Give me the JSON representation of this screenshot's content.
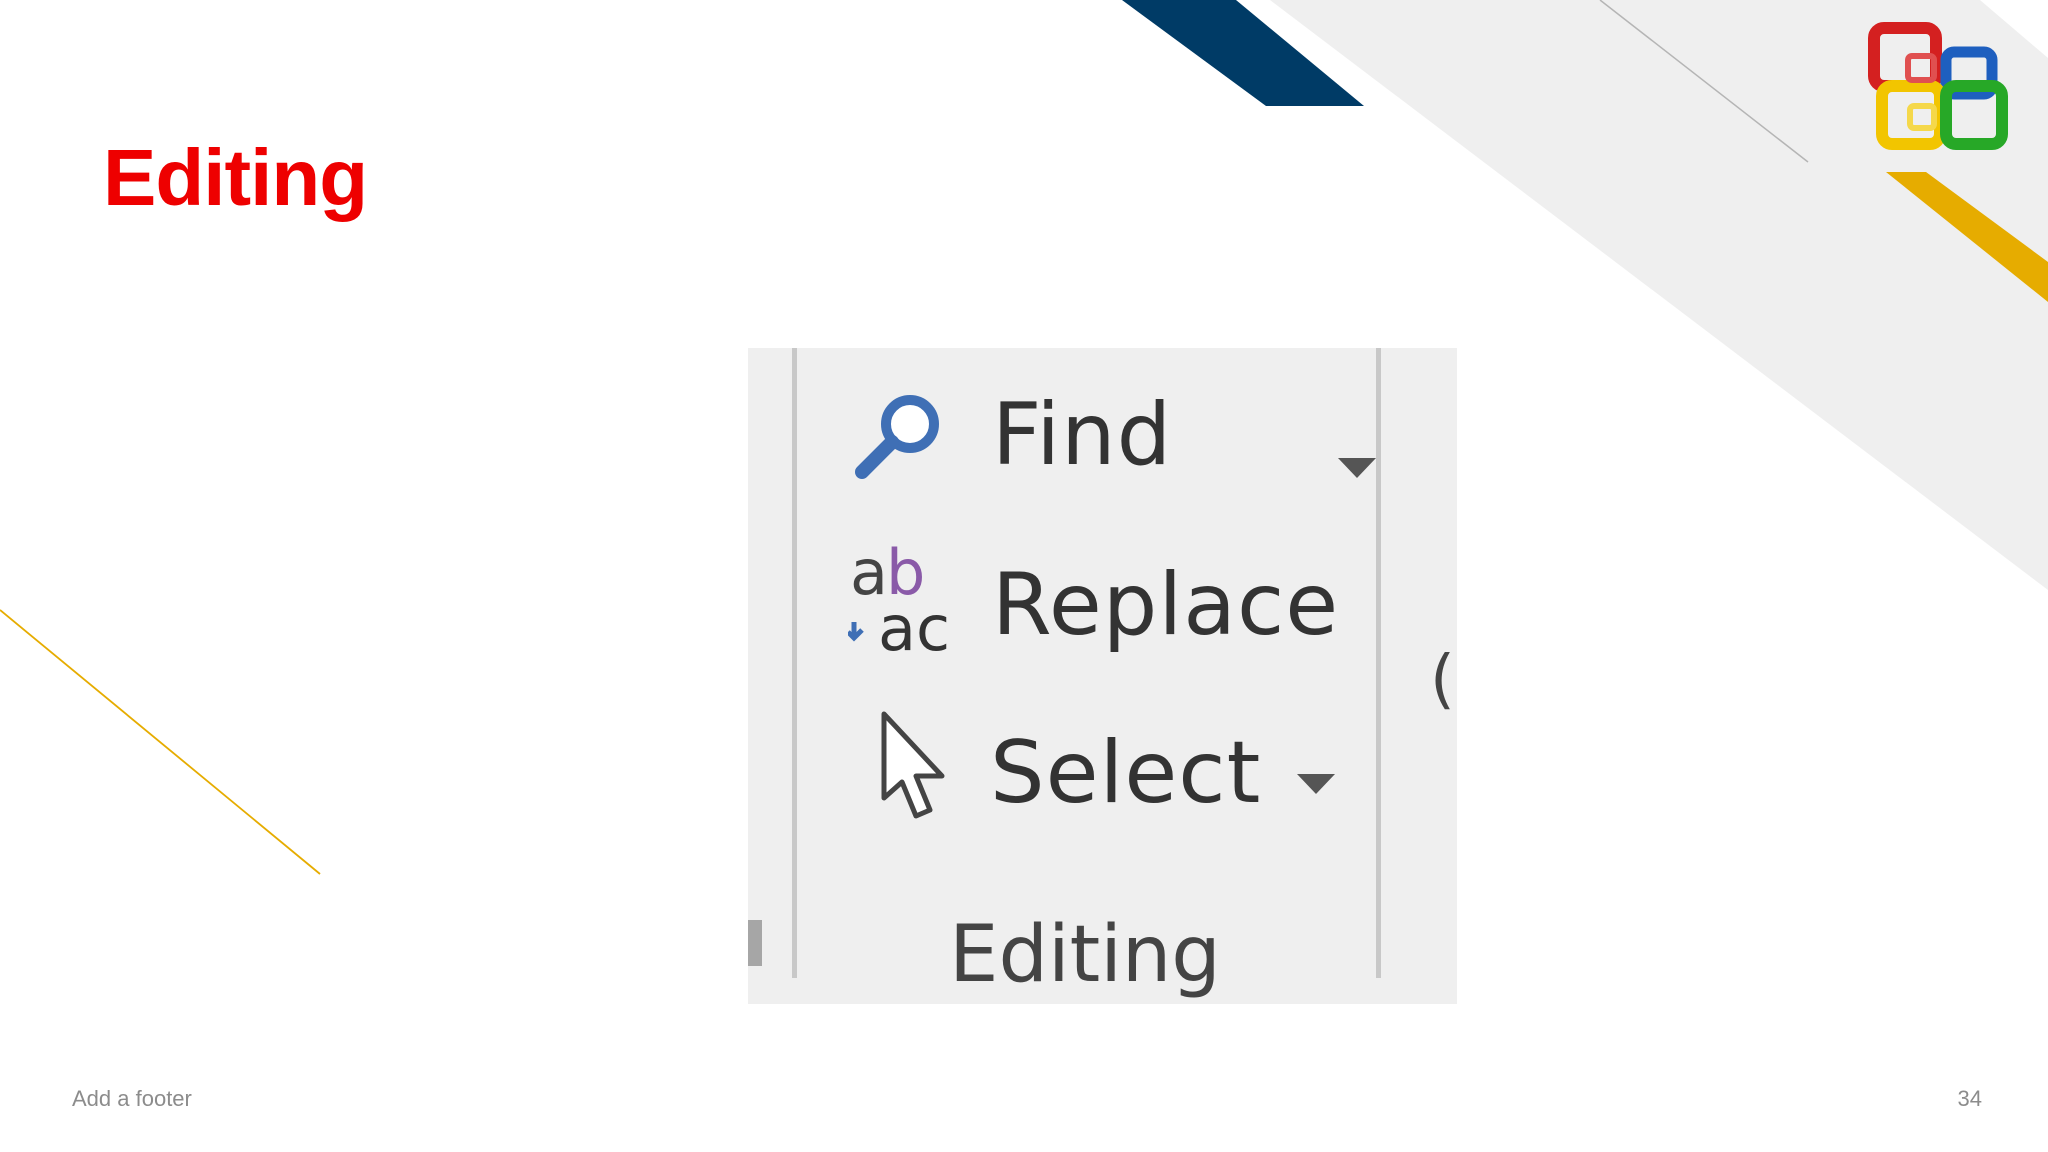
{
  "slide": {
    "title": "Editing",
    "footer": "Add a footer",
    "page_number": "34"
  },
  "ribbon_group": {
    "commands": [
      {
        "label": "Find",
        "icon": "magnifier-icon",
        "has_dropdown": true
      },
      {
        "label": "Replace",
        "icon": "replace-ab-ac-icon",
        "has_dropdown": false
      },
      {
        "label": "Select",
        "icon": "arrow-cursor-icon",
        "has_dropdown": true
      }
    ],
    "group_label": "Editing",
    "right_stub": "("
  },
  "colors": {
    "title": "#ee0000",
    "navy_stripe": "#003b66",
    "gold_stripe": "#e6ac00",
    "gray_band": "#efefef",
    "ribbon_bg": "#efefef",
    "footer_text": "#8c8c8c"
  },
  "icons": {
    "logo": "office-logo-icon"
  }
}
